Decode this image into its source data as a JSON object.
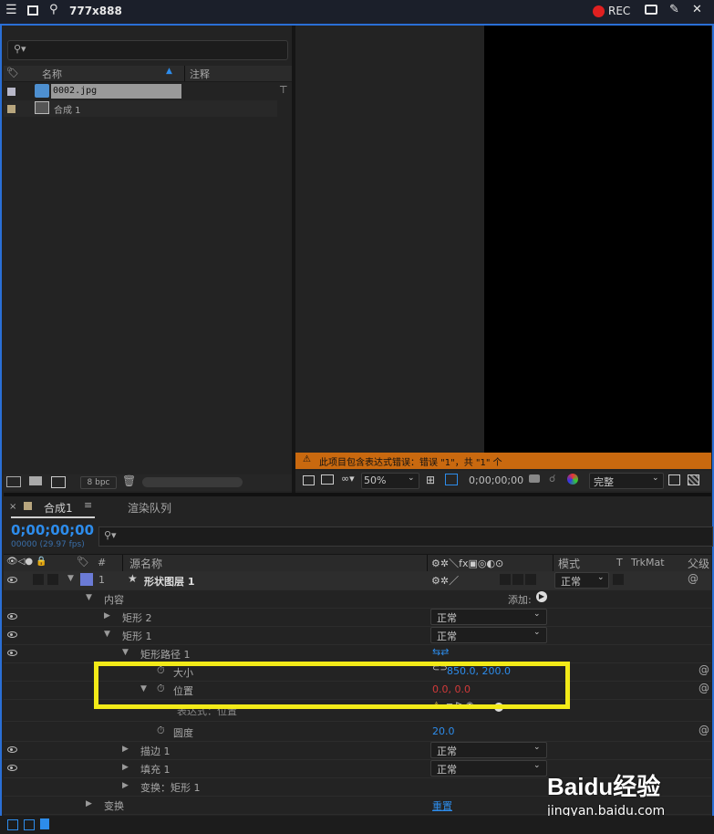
{
  "topbar": {
    "title": "777x888",
    "rec": "REC"
  },
  "project": {
    "col_name": "名称",
    "col_comment": "注释",
    "items": [
      {
        "name": "0002.jpg",
        "swatch": "#b7b7c8"
      },
      {
        "name": "合成 1",
        "swatch": "#b8a67e"
      }
    ],
    "bpc": "8 bpc"
  },
  "viewer": {
    "error": "此项目包含表达式错误：错误 \"1\"，共 \"1\" 个",
    "zoom": "50%",
    "timecode": "0;00;00;00",
    "quality": "完整"
  },
  "timeline": {
    "tab_comp": "合成1",
    "tab_render": "渲染队列",
    "timecode": "0;00;00;00",
    "frames": "00000 (29.97 fps)",
    "col_hash": "#",
    "col_source": "源名称",
    "col_mode": "模式",
    "col_t": "T",
    "col_trkmat": "TrkMat",
    "col_parent": "父级",
    "layer_num": "1",
    "layer_name": "形状图层 1",
    "layer_mode": "正常",
    "contents": "内容",
    "add": "添加:",
    "rect2": "矩形 2",
    "rect1": "矩形 1",
    "rect_path": "矩形路径 1",
    "size_label": "大小",
    "size_value": "850.0, 200.0",
    "pos_label": "位置",
    "pos_value": "0.0, 0.0",
    "expr_label": "表达式：位置",
    "round_label": "圆度",
    "round_value": "20.0",
    "stroke": "描边 1",
    "fill": "填充 1",
    "xform_rect": "变换：矩形 1",
    "xform": "变换",
    "reset": "重置",
    "normal": "正常"
  },
  "watermark": {
    "brand": "Baidu经验",
    "url": "jingyan.baidu.com"
  },
  "colors": {
    "highlight": "#f2ea18",
    "accent": "#2d8ceb",
    "error_bar": "#c9690f",
    "layer_label": "#6b7bd6"
  }
}
